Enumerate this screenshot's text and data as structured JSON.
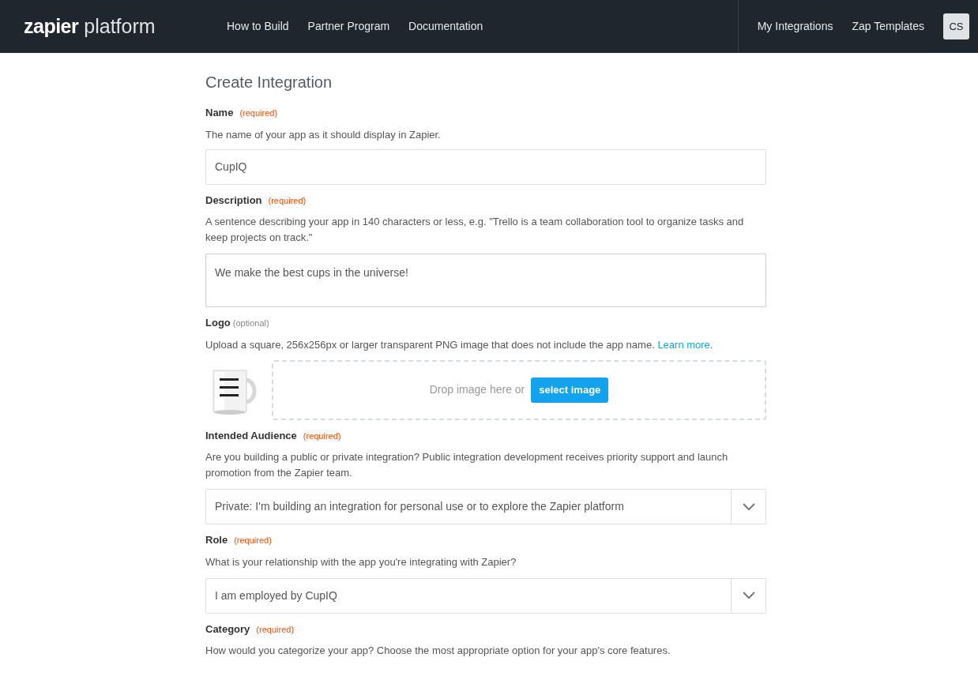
{
  "header": {
    "logo": {
      "brand": "zapier",
      "product": "platform"
    },
    "nav": [
      "How to Build",
      "Partner Program",
      "Documentation"
    ],
    "right_nav": [
      "My Integrations",
      "Zap Templates"
    ],
    "avatar": "CS"
  },
  "page_title": "Create Integration",
  "fields": [
    {
      "kind": "text",
      "label": "Name",
      "tag": "(required)",
      "required": true,
      "hint": "The name of your app as it should display in Zapier.",
      "value": "CupIQ"
    },
    {
      "kind": "textarea",
      "label": "Description",
      "tag": "(required)",
      "required": true,
      "hint": "A sentence describing your app in 140 characters or less, e.g. \"Trello is a team collaboration tool to organize tasks and keep projects on track.\"",
      "value": "We make the best cups in the universe!"
    },
    {
      "kind": "logo",
      "label": "Logo",
      "tag": "(optional)",
      "required": false,
      "hint": "Upload a square, 256x256px or larger transparent PNG image that does not include the app name.",
      "link": "Learn more",
      "suffix": ".",
      "drop_text": "Drop image here or",
      "button": "select image"
    },
    {
      "kind": "select",
      "label": "Intended Audience",
      "tag": "(required)",
      "required": true,
      "hint": "Are you building a public or private integration? Public integration development receives priority support and launch promotion from the Zapier team.",
      "value": "Private: I'm building an integration for personal use or to explore the Zapier platform"
    },
    {
      "kind": "select",
      "label": "Role",
      "tag": "(required)",
      "required": true,
      "hint": "What is your relationship with the app you're integrating with Zapier?",
      "value": "I am employed by CupIQ"
    },
    {
      "kind": "heading",
      "label": "Category",
      "tag": "(required)",
      "required": true,
      "hint": "How would you categorize your app? Choose the most appropriate option for your app's core features."
    }
  ]
}
